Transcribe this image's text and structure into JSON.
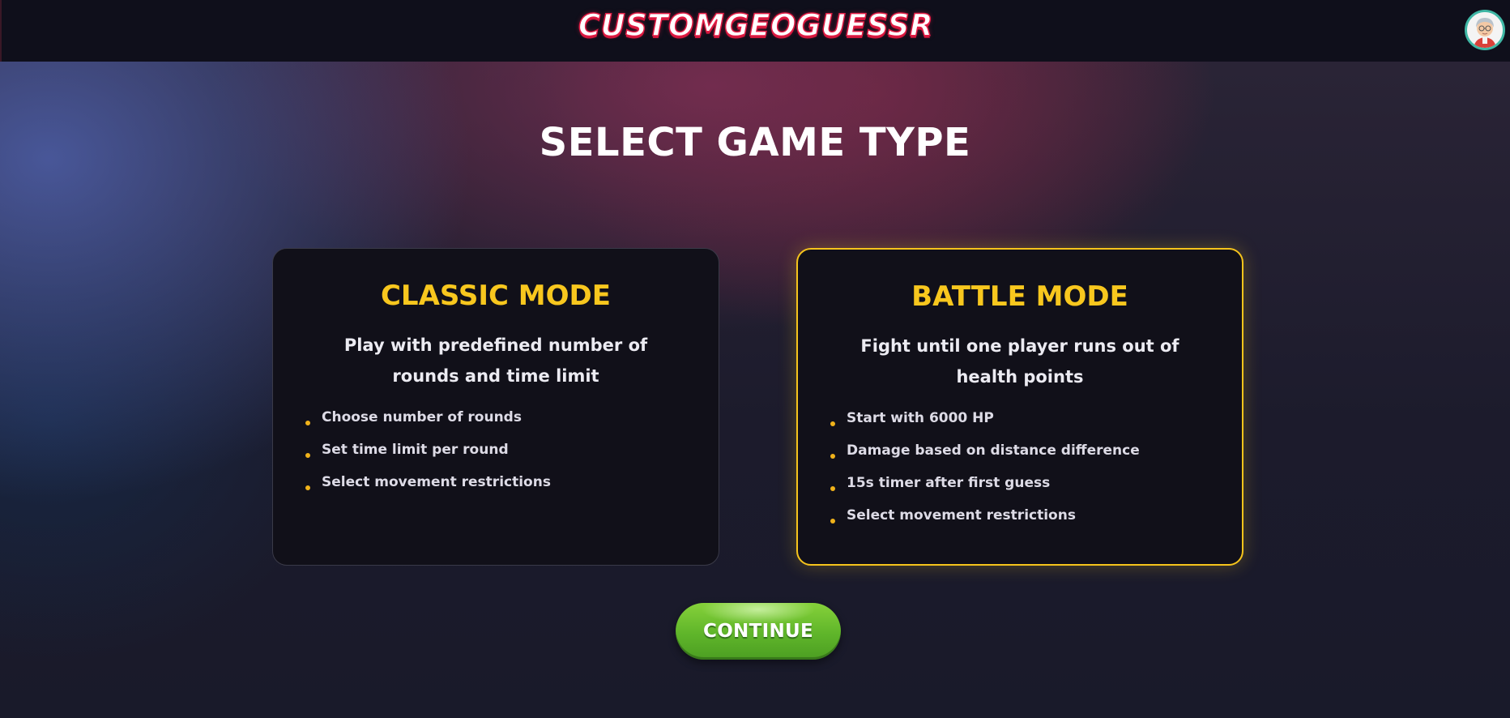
{
  "header": {
    "logo_text": "CUSTOMGEOGUESSR",
    "avatar_icon": "user-avatar-icon"
  },
  "page": {
    "title": "SELECT GAME TYPE"
  },
  "modes": [
    {
      "title": "CLASSIC MODE",
      "description": "Play with predefined number of rounds and time limit",
      "features": [
        "Choose number of rounds",
        "Set time limit per round",
        "Select movement restrictions"
      ],
      "selected": false
    },
    {
      "title": "BATTLE MODE",
      "description": "Fight until one player runs out of health points",
      "features": [
        "Start with 6000 HP",
        "Damage based on distance difference",
        "15s timer after first guess",
        "Select movement restrictions"
      ],
      "selected": true
    }
  ],
  "actions": {
    "continue_label": "CONTINUE"
  },
  "colors": {
    "accent_yellow": "#f8c71e",
    "logo_red": "#e21d45",
    "continue_green": "#5fb52a",
    "card_background": "#111019"
  }
}
